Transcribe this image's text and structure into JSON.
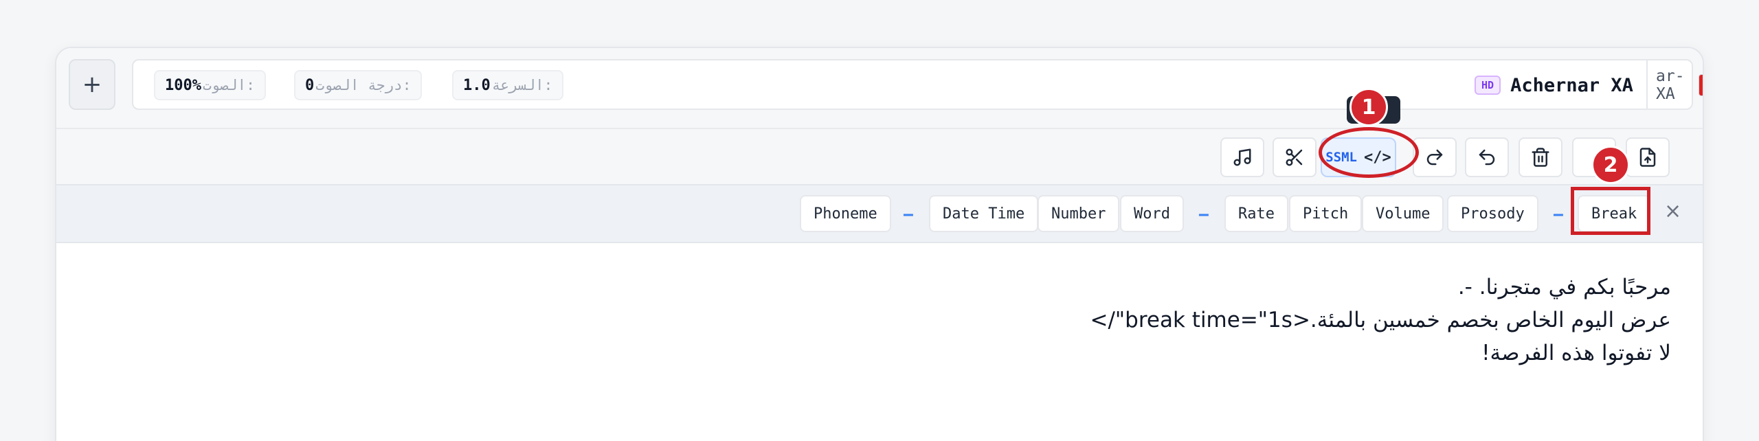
{
  "header": {
    "add_label": "+",
    "volume": {
      "label": "الصوت:",
      "value": "100%"
    },
    "pitch": {
      "label": "درجة الصوت:",
      "value": "0"
    },
    "speed": {
      "label": "السرعة:",
      "value": "1.0"
    },
    "hd_badge": "HD",
    "voice_name": "Achernar XA",
    "locale": "ar-XA"
  },
  "toolbar": {
    "ssml_label": "SSML",
    "ssml_code": "</>"
  },
  "tags": {
    "phoneme": "Phoneme",
    "date_time": "Date Time",
    "number": "Number",
    "word": "Word",
    "rate": "Rate",
    "pitch": "Pitch",
    "volume": "Volume",
    "prosody": "Prosody",
    "break": "Break",
    "separator": "−",
    "close": "×"
  },
  "editor": {
    "lines": [
      "مرحبًا بكم في متجرنا. -.",
      "عرض اليوم الخاص بخصم خمسين بالمئة.<break time=\"1s\"/>",
      "لا تفوتوا هذه الفرصة!"
    ]
  },
  "annotations": {
    "marker1": "1",
    "marker2": "2"
  },
  "colors": {
    "accent": "#2563eb",
    "annotation": "#cf2027"
  }
}
